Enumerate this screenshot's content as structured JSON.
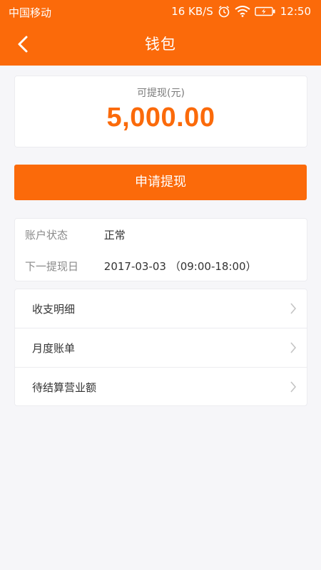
{
  "status_bar": {
    "carrier": "中国移动",
    "speed": "16 KB/S",
    "time": "12:50",
    "icons": [
      "alarm-icon",
      "wifi-icon",
      "battery-icon"
    ]
  },
  "navbar": {
    "back_icon": "chevron-left-icon",
    "title": "钱包"
  },
  "balance": {
    "label": "可提现(元)",
    "amount": "5,000.00"
  },
  "withdraw_button": {
    "label": "申请提现"
  },
  "account_info": {
    "status_label": "账户状态",
    "status_value": "正常",
    "next_date_label": "下一提现日",
    "next_date_value": "2017-03-03 （09:00-18:00）"
  },
  "menu": {
    "items": [
      {
        "label": "收支明细"
      },
      {
        "label": "月度账单"
      },
      {
        "label": "待结算营业额"
      }
    ]
  },
  "colors": {
    "accent": "#fb6a0a",
    "background": "#f6f6f9"
  }
}
